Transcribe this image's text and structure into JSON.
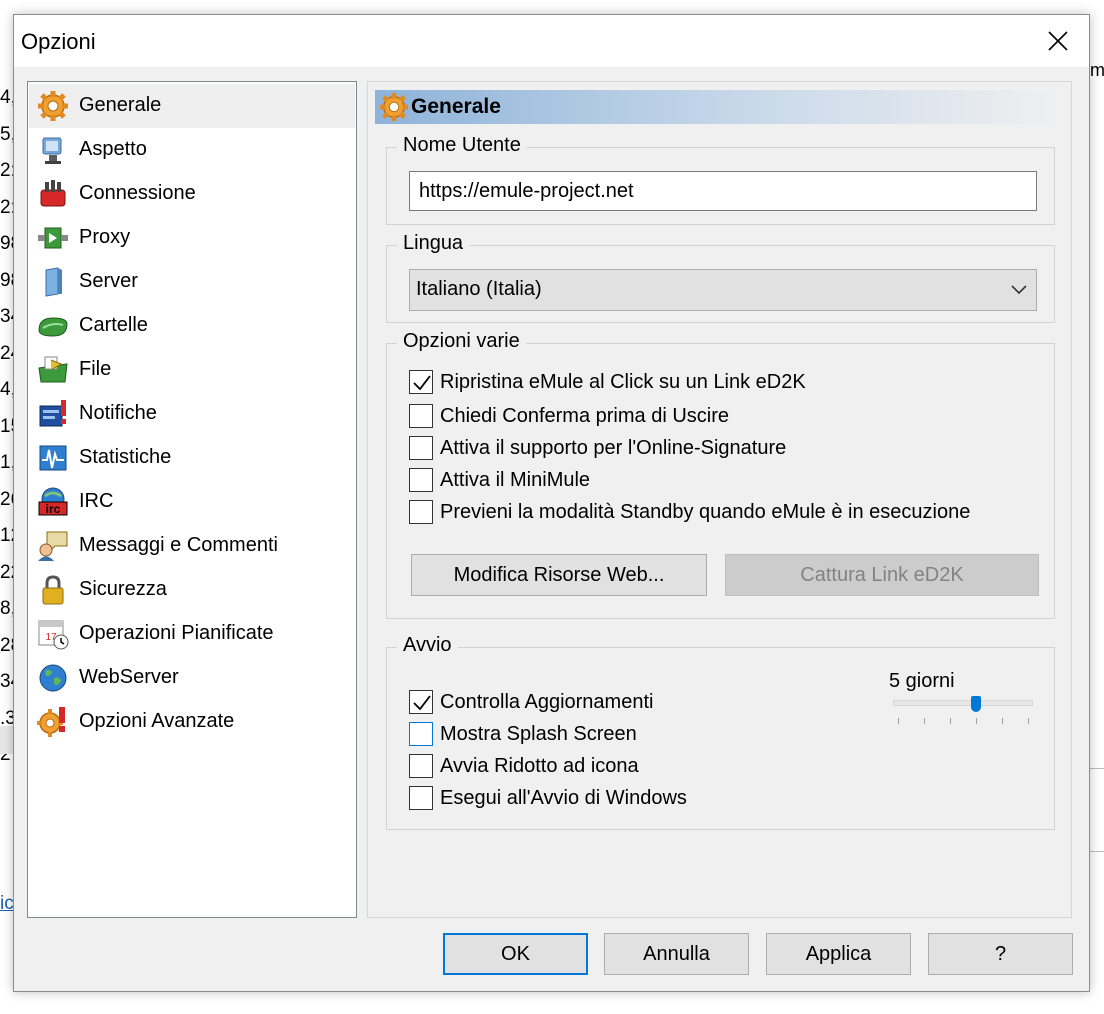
{
  "background": {
    "left_fragments": [
      "4,",
      "5,",
      "2:",
      "2:",
      "98",
      "98",
      "34",
      "24",
      "4,",
      "15",
      "1,",
      "26",
      "12",
      "22",
      "8,",
      "28",
      "34",
      ".3",
      "2"
    ],
    "right_fragment": "m",
    "link_fragment": "ic"
  },
  "dialog": {
    "title": "Opzioni",
    "close_glyph": "✕"
  },
  "nav": {
    "items": [
      {
        "label": "Generale",
        "icon": "gear-icon",
        "selected": true
      },
      {
        "label": "Aspetto",
        "icon": "display-icon"
      },
      {
        "label": "Connessione",
        "icon": "connection-icon"
      },
      {
        "label": "Proxy",
        "icon": "proxy-icon"
      },
      {
        "label": "Server",
        "icon": "server-icon"
      },
      {
        "label": "Cartelle",
        "icon": "folder-icon"
      },
      {
        "label": "File",
        "icon": "file-icon"
      },
      {
        "label": "Notifiche",
        "icon": "notification-icon"
      },
      {
        "label": "Statistiche",
        "icon": "statistics-icon"
      },
      {
        "label": "IRC",
        "icon": "irc-icon"
      },
      {
        "label": "Messaggi e Commenti",
        "icon": "messages-icon"
      },
      {
        "label": "Sicurezza",
        "icon": "lock-icon"
      },
      {
        "label": "Operazioni Pianificate",
        "icon": "calendar-icon"
      },
      {
        "label": "WebServer",
        "icon": "globe-icon"
      },
      {
        "label": "Opzioni Avanzate",
        "icon": "advanced-gear-icon"
      }
    ]
  },
  "panel": {
    "header_title": "Generale",
    "username_group": {
      "label": "Nome Utente",
      "value": "https://emule-project.net"
    },
    "language_group": {
      "label": "Lingua",
      "selected": "Italiano (Italia)"
    },
    "misc_group": {
      "label": "Opzioni varie",
      "checkboxes": [
        {
          "label": "Ripristina eMule al Click su un Link eD2K",
          "checked": true
        },
        {
          "label": "Chiedi Conferma prima di Uscire",
          "checked": false
        },
        {
          "label": "Attiva il supporto per l'Online-Signature",
          "checked": false
        },
        {
          "label": "Attiva il MiniMule",
          "checked": false
        },
        {
          "label": "Previeni la modalità Standby quando eMule è in esecuzione",
          "checked": false
        }
      ],
      "edit_web_button": "Modifica Risorse Web...",
      "capture_link_button": "Cattura Link eD2K"
    },
    "startup_group": {
      "label": "Avvio",
      "checkboxes": [
        {
          "label": "Controlla Aggiornamenti",
          "checked": true
        },
        {
          "label": "Mostra Splash Screen",
          "checked": false,
          "focused": true
        },
        {
          "label": "Avvia Ridotto ad icona",
          "checked": false
        },
        {
          "label": "Esegui all'Avvio di Windows",
          "checked": false
        }
      ],
      "update_interval_label": "5 giorni",
      "update_interval_fraction": 0.6
    }
  },
  "footer": {
    "ok": "OK",
    "cancel": "Annulla",
    "apply": "Applica",
    "help": "?"
  },
  "colors": {
    "accent": "#0078d7",
    "header_gradient_start": "#8fb3d9",
    "dialog_bg": "#f0f0f0"
  }
}
